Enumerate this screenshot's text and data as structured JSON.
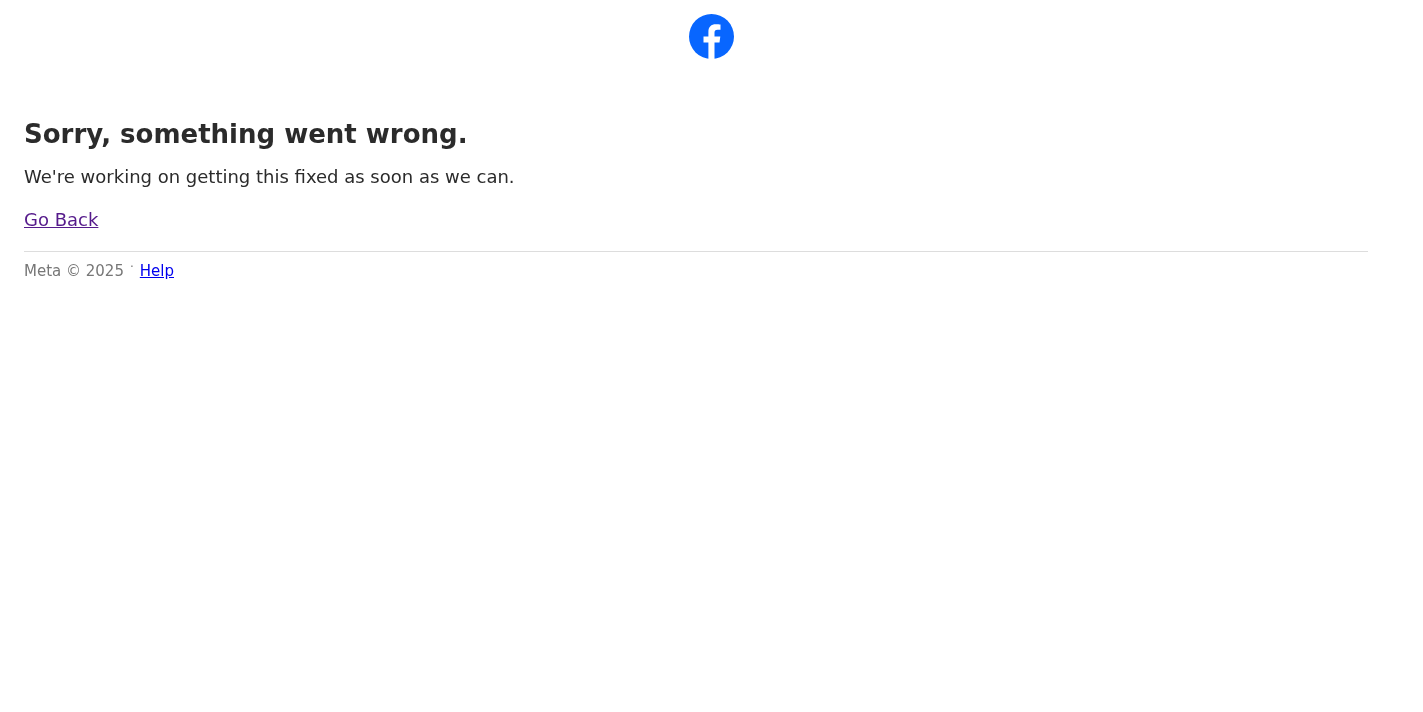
{
  "heading": "Sorry, something went wrong.",
  "message": "We're working on getting this fixed as soon as we can.",
  "back_link": "Go Back",
  "footer": {
    "copyright": "Meta © 2025",
    "separator": "·",
    "help_link": "Help"
  }
}
